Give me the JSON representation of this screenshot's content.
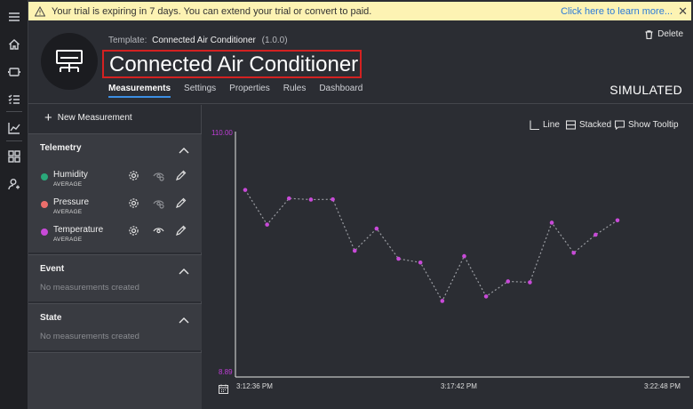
{
  "banner": {
    "message": "Your trial is expiring in 7 days. You can extend your trial or convert to paid.",
    "link": "Click here to learn more...",
    "close": "✕"
  },
  "header": {
    "template_label": "Template:",
    "template_name": "Connected Air Conditioner",
    "template_version": "(1.0.0)",
    "title": "Connected Air Conditioner",
    "delete_label": "Delete",
    "status": "SIMULATED",
    "tabs": [
      {
        "label": "Measurements",
        "active": true
      },
      {
        "label": "Settings",
        "active": false
      },
      {
        "label": "Properties",
        "active": false
      },
      {
        "label": "Rules",
        "active": false
      },
      {
        "label": "Dashboard",
        "active": false
      }
    ]
  },
  "panel": {
    "new_measurement": "New Measurement",
    "telemetry": {
      "heading": "Telemetry",
      "items": [
        {
          "name": "Humidity",
          "aggregation": "AVERAGE",
          "color": "#2aa87a",
          "visible": false
        },
        {
          "name": "Pressure",
          "aggregation": "AVERAGE",
          "color": "#ec6e6b",
          "visible": false
        },
        {
          "name": "Temperature",
          "aggregation": "AVERAGE",
          "color": "#c84ad8",
          "visible": true
        }
      ]
    },
    "event": {
      "heading": "Event",
      "empty": "No measurements created"
    },
    "state": {
      "heading": "State",
      "empty": "No measurements created"
    }
  },
  "chart_controls": {
    "line": "Line",
    "stacked": "Stacked",
    "tooltip": "Show Tooltip"
  },
  "chart_data": {
    "type": "line",
    "series": [
      {
        "color": "#c84ad8",
        "values": [
          86.0,
          71.3,
          82.4,
          81.9,
          82.0,
          60.2,
          69.6,
          56.8,
          55.2,
          38.9,
          57.9,
          40.8,
          47.2,
          46.8,
          72.1,
          59.3,
          67.0,
          73.1
        ]
      }
    ],
    "ylim": [
      8.89,
      110.0
    ],
    "y_ticks": [
      "110.00",
      "8.89"
    ],
    "x_ticks": [
      "3:12:36 PM",
      "3:17:42 PM",
      "3:22:48 PM"
    ],
    "grid": false
  }
}
